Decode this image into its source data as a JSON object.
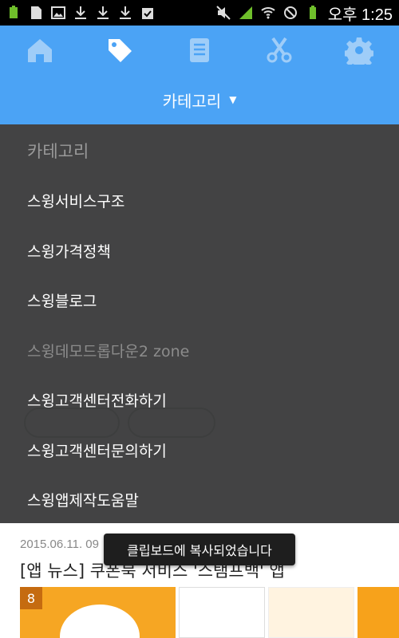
{
  "status_bar": {
    "left_icons": [
      "battery-small-icon",
      "sim-card-icon",
      "image-icon",
      "download-icon",
      "download-icon",
      "download-icon",
      "clipboard-check-icon"
    ],
    "right_icons": [
      "mute-icon",
      "signal-icon",
      "wifi-icon",
      "no-sim-icon",
      "battery-icon"
    ],
    "time": "오후 1:25"
  },
  "header": {
    "tabs": [
      {
        "name": "home",
        "icon": "home-icon"
      },
      {
        "name": "tags",
        "icon": "tag-icon"
      },
      {
        "name": "document",
        "icon": "document-icon"
      },
      {
        "name": "coupon",
        "icon": "scissors-icon"
      },
      {
        "name": "settings",
        "icon": "gear-icon"
      }
    ],
    "category_label": "카테고리",
    "accent_color": "#4ba3f5"
  },
  "dropdown": {
    "heading": "카테고리",
    "items": [
      {
        "label": "스윙서비스구조"
      },
      {
        "label": "스윙가격정책"
      },
      {
        "label": "스윙블로그"
      },
      {
        "label": "스윙데모드롭다운2 zone"
      },
      {
        "label": "스윙고객센터전화하기"
      },
      {
        "label": "스윙고객센터문의하기"
      },
      {
        "label": "스윙앱제작도움말"
      }
    ]
  },
  "article": {
    "date": "2015.06.11. 09",
    "title": "[앱 뉴스] 쿠폰북 서비스 '스탬프백' 앱",
    "thumb_badge": "8"
  },
  "toast": {
    "text": "클립보드에 복사되었습니다"
  }
}
